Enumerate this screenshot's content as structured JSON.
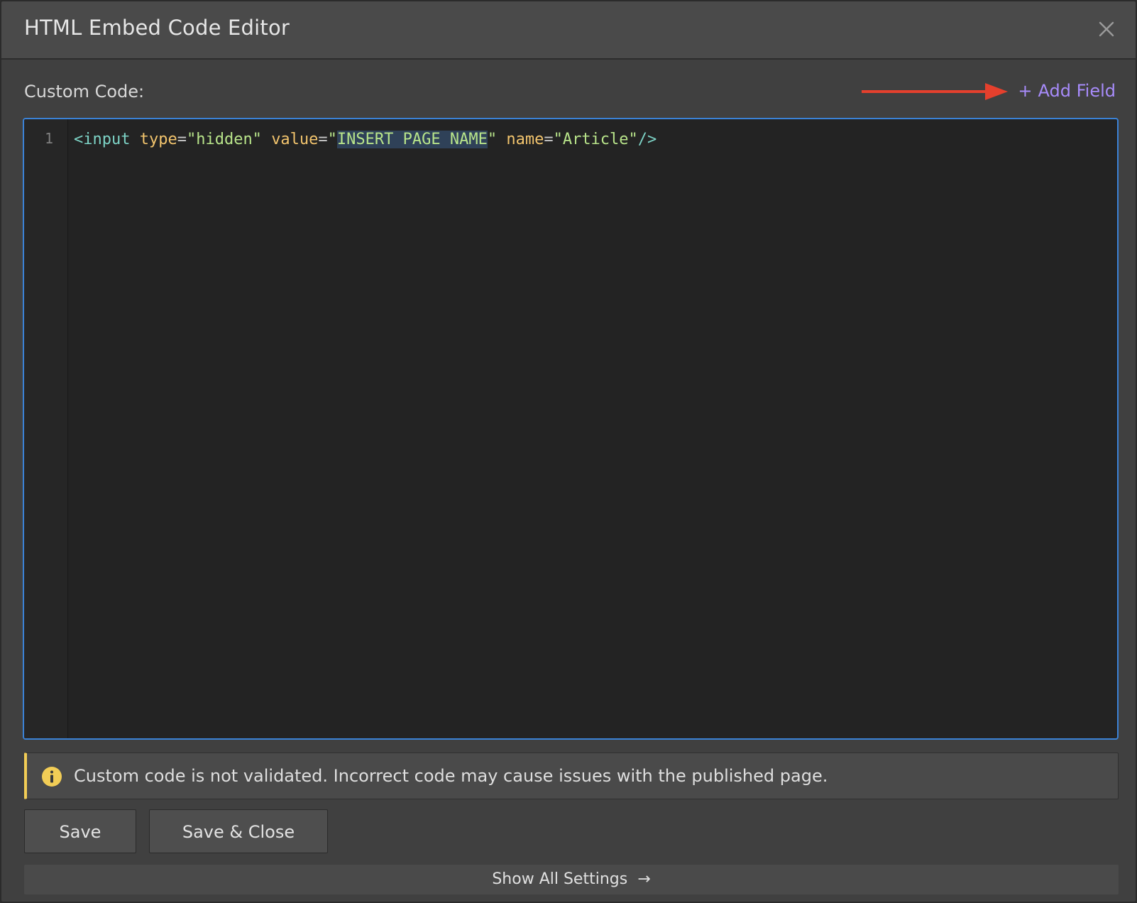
{
  "dialog": {
    "title": "HTML Embed Code Editor",
    "close_icon": "close-icon"
  },
  "form": {
    "custom_code_label": "Custom Code:",
    "add_field_plus": "+",
    "add_field_label": "Add Field"
  },
  "editor": {
    "line_number": "1",
    "tokens": {
      "t1": "<input",
      "t2": " ",
      "t3": "type",
      "t4": "=",
      "t5": "\"hidden\"",
      "t6": " ",
      "t7": "value",
      "t8": "=",
      "t9": "\"",
      "t10": "INSERT PAGE NAME",
      "t11": "\"",
      "t12": " ",
      "t13": "name",
      "t14": "=",
      "t15": "\"Article\"",
      "t16": "/>"
    },
    "selected_text": "INSERT PAGE NAME"
  },
  "warning": {
    "icon": "info-icon",
    "text": "Custom code is not validated. Incorrect code may cause issues with the published page.",
    "accent_color": "#f2cd56"
  },
  "buttons": {
    "save_label": "Save",
    "save_close_label": "Save & Close"
  },
  "footer": {
    "show_all_label": "Show All Settings",
    "arrow_glyph": "→"
  },
  "colors": {
    "accent_link": "#a78bfa",
    "editor_focus_border": "#3b82d6",
    "annotation_arrow": "#e5402d"
  }
}
